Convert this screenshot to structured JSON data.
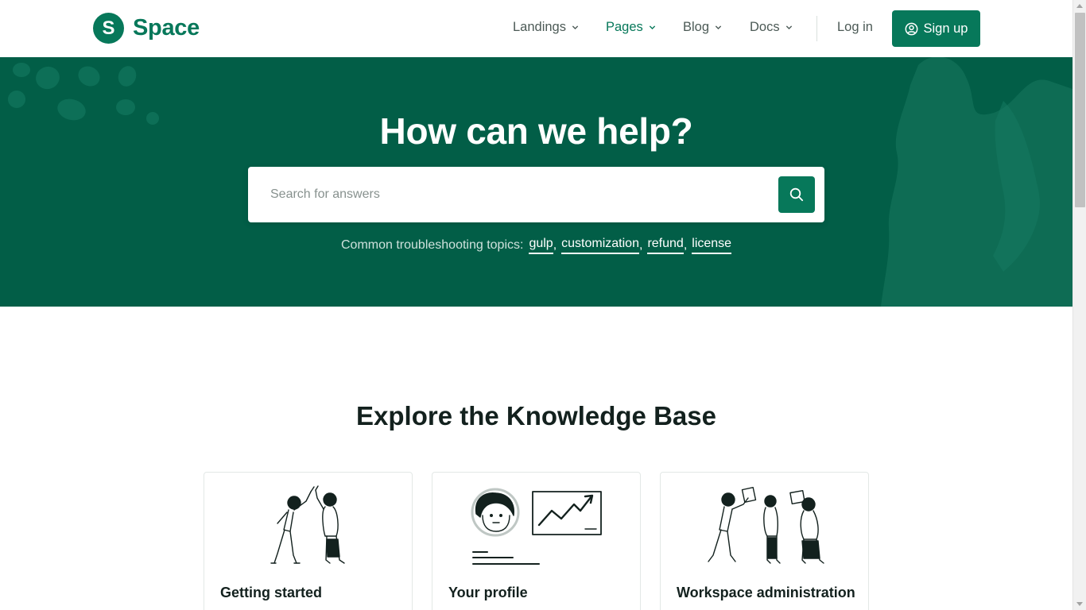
{
  "brand": {
    "logo_letter": "S",
    "name": "Space",
    "color": "#07785a"
  },
  "nav": {
    "items": [
      {
        "label": "Landings",
        "icon": "chevron-down-icon"
      },
      {
        "label": "Pages",
        "icon": "chevron-down-icon",
        "active": true
      },
      {
        "label": "Blog",
        "icon": "chevron-down-icon"
      },
      {
        "label": "Docs",
        "icon": "chevron-down-icon"
      }
    ],
    "login_label": "Log in",
    "signup_label": "Sign up",
    "signup_icon": "user-circle-icon"
  },
  "hero": {
    "title": "How can we help?",
    "search_placeholder": "Search for answers",
    "search_icon": "search-icon",
    "topics_label": "Common troubleshooting topics:",
    "topics": [
      "gulp",
      "customization",
      "refund",
      "license"
    ],
    "background_color": "#025e47"
  },
  "kb": {
    "title": "Explore the Knowledge Base",
    "cards": [
      {
        "title": "Getting started",
        "illustration": "high-five-people-illustration"
      },
      {
        "title": "Your profile",
        "illustration": "profile-chart-illustration"
      },
      {
        "title": "Workspace administration",
        "illustration": "team-documents-illustration"
      }
    ]
  }
}
